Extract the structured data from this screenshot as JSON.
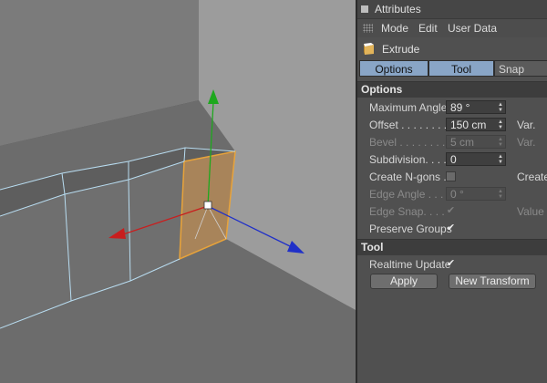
{
  "window": {
    "title": "Attributes"
  },
  "menu": [
    "Mode",
    "Edit",
    "User Data"
  ],
  "object": {
    "name": "Extrude",
    "icon": "extrude-icon"
  },
  "tabs": [
    {
      "label": "Options",
      "active": true
    },
    {
      "label": "Tool",
      "active": true
    },
    {
      "label": "Snap Settings",
      "active": false
    }
  ],
  "sections": {
    "options": "Options",
    "tool": "Tool"
  },
  "options": {
    "max_angle": {
      "label": "Maximum Angle",
      "value": "89 °"
    },
    "offset": {
      "label": "Offset . . . . . . . .",
      "value": "150 cm",
      "right_label": "Var."
    },
    "bevel": {
      "label": "Bevel . . . . . . . .",
      "value": "5 cm",
      "right_label": "Var."
    },
    "subdivision": {
      "label": "Subdivision. . . .",
      "value": "0"
    },
    "create_ngons": {
      "label": "Create N-gons . .",
      "checked": false,
      "right_label": "Create"
    },
    "edge_angle": {
      "label": "Edge Angle . . .",
      "value": "0 °"
    },
    "edge_snap": {
      "label": "Edge Snap. . . .",
      "checked": true,
      "right_label": "Value"
    },
    "preserve_groups": {
      "label": "Preserve Groups",
      "checked": true
    }
  },
  "tool": {
    "realtime_update": {
      "label": "Realtime Update",
      "checked": true
    },
    "apply_label": "Apply",
    "new_transform_label": "New Transform"
  },
  "glyphs": {
    "check": "✔",
    "up": "▲",
    "down": "▼"
  },
  "colors": {
    "tab_active": "#89a5c6",
    "selection": "#e8a33a",
    "axis_x": "#c81e1e",
    "axis_y": "#1ea81e",
    "axis_z": "#2030c8"
  }
}
